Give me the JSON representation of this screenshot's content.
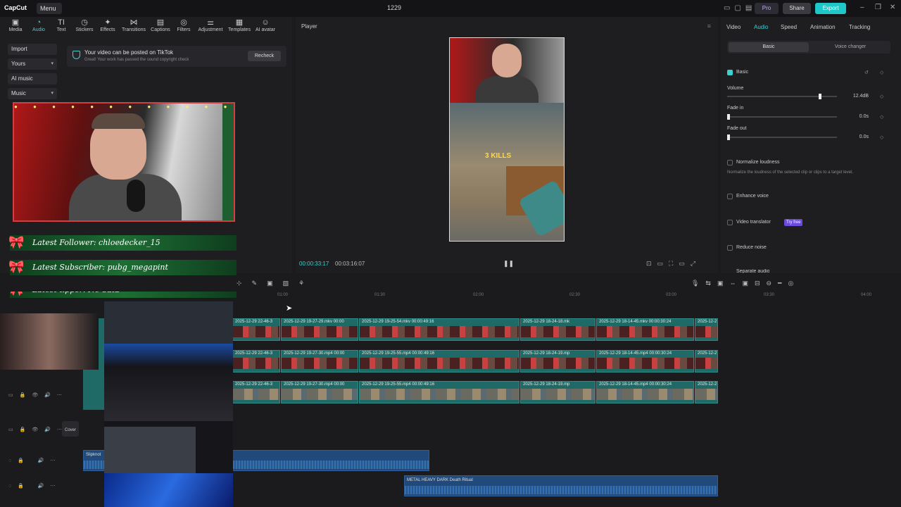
{
  "titlebar": {
    "logo": "CapCut",
    "menu": "Menu",
    "title": "1229",
    "pro": "Pro",
    "share": "Share",
    "export": "Export"
  },
  "toolbar": {
    "items": [
      "Media",
      "Audio",
      "Text",
      "Stickers",
      "Effects",
      "Transitions",
      "Captions",
      "Filters",
      "Adjustment",
      "Templates",
      "AI avatar"
    ]
  },
  "left_panel": {
    "nav": [
      "Import",
      "Yours",
      "AI music",
      "Music"
    ],
    "notice_title": "Your video can be posted on TikTok",
    "notice_sub": "Great! Your work has passed the sound copyright check",
    "recheck": "Recheck"
  },
  "overlay": {
    "follower": "Latest Follower: chloedecker_15",
    "subscriber": "Latest Subscriber: pubg_megapint",
    "tipper": "Latest tipper: No data"
  },
  "player": {
    "title": "Player",
    "current_time": "00:00:33:17",
    "total_time": "00:03:16:07",
    "overlay_text": "3 KILLS"
  },
  "right_panel": {
    "tabs": [
      "Video",
      "Audio",
      "Speed",
      "Animation",
      "Tracking"
    ],
    "seg_basic": "Basic",
    "seg_voice": "Voice changer",
    "basic": "Basic",
    "volume": "Volume",
    "volume_val": "12.4dB",
    "fade_in": "Fade in",
    "fade_in_val": "0.0s",
    "fade_out": "Fade out",
    "fade_out_val": "0.0s",
    "normalize": "Normalize loudness",
    "normalize_desc": "Normalize the loudness of the selected clip or clips to a target level.",
    "enhance": "Enhance voice",
    "translator": "Video translator",
    "try_free": "Try free",
    "reduce": "Reduce noise",
    "separate": "Separate audio"
  },
  "ruler": [
    "01:00",
    "01:30",
    "02:00",
    "02:30",
    "03:00",
    "03:30",
    "04:00"
  ],
  "tracks": {
    "row1": [
      {
        "label": "2025-12-29 22-46-3"
      },
      {
        "label": "2025-12-29 19-27-29.mkv  00:00"
      },
      {
        "label": "2025-12-29 19-25-54.mkv  00:00:49:16"
      },
      {
        "label": "2025-12-29 18-24-18.mk"
      },
      {
        "label": "2025-12-29 18-14-45.mkv  00:00:30:24"
      },
      {
        "label": "2025-12-2"
      }
    ],
    "row2": [
      {
        "label": "2025-12-29 22-46-3"
      },
      {
        "label": "2025-12-29 19-27-30.mp4  00:00"
      },
      {
        "label": "2025-12-29 19-25-55.mp4  00:00:49:16"
      },
      {
        "label": "2025-12-29 18-24-19.mp"
      },
      {
        "label": "2025-12-29 18-14-45.mp4  00:00:30:24"
      },
      {
        "label": "2025-12-2"
      }
    ],
    "row3": [
      {
        "label": "2025-12-29 22-46-3"
      },
      {
        "label": "2025-12-29 19-27-30.mp4  00:00"
      },
      {
        "label": "2025-12-29 19-25-55.mp4  00:00:49:16"
      },
      {
        "label": "2025-12-29 18-24-19.mp"
      },
      {
        "label": "2025-12-29 18-14-45.mp4  00:00:30:24"
      },
      {
        "label": "2025-12-2"
      }
    ],
    "audio1": "Slipknot",
    "audio2": "METAL HEAVY DARK Death Ritual",
    "cover": "Cover"
  }
}
